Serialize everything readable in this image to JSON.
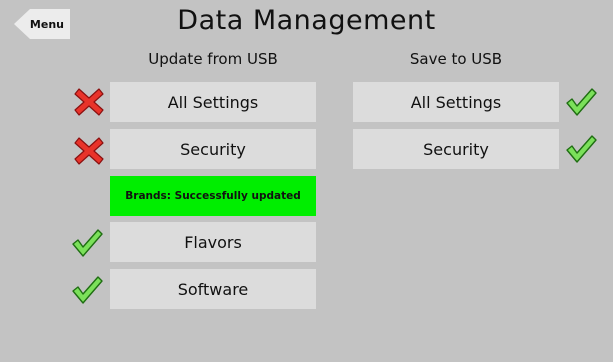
{
  "menu_label": "Menu",
  "title": "Data Management",
  "update_column": {
    "header": "Update from USB",
    "items": [
      {
        "label": "All Settings",
        "status_icon": "cross-icon"
      },
      {
        "label": "Security",
        "status_icon": "cross-icon"
      },
      {
        "label": "Flavors",
        "status_icon": "check-icon"
      },
      {
        "label": "Software",
        "status_icon": "check-icon"
      }
    ],
    "banner": "Brands: Successfully updated"
  },
  "save_column": {
    "header": "Save to USB",
    "items": [
      {
        "label": "All Settings",
        "status_icon": "check-icon"
      },
      {
        "label": "Security",
        "status_icon": "check-icon"
      }
    ]
  },
  "colors": {
    "background": "#c3c3c3",
    "button": "#dcdcdc",
    "banner": "#00ee00",
    "check": "#7be05a",
    "cross": "#e8332a"
  }
}
